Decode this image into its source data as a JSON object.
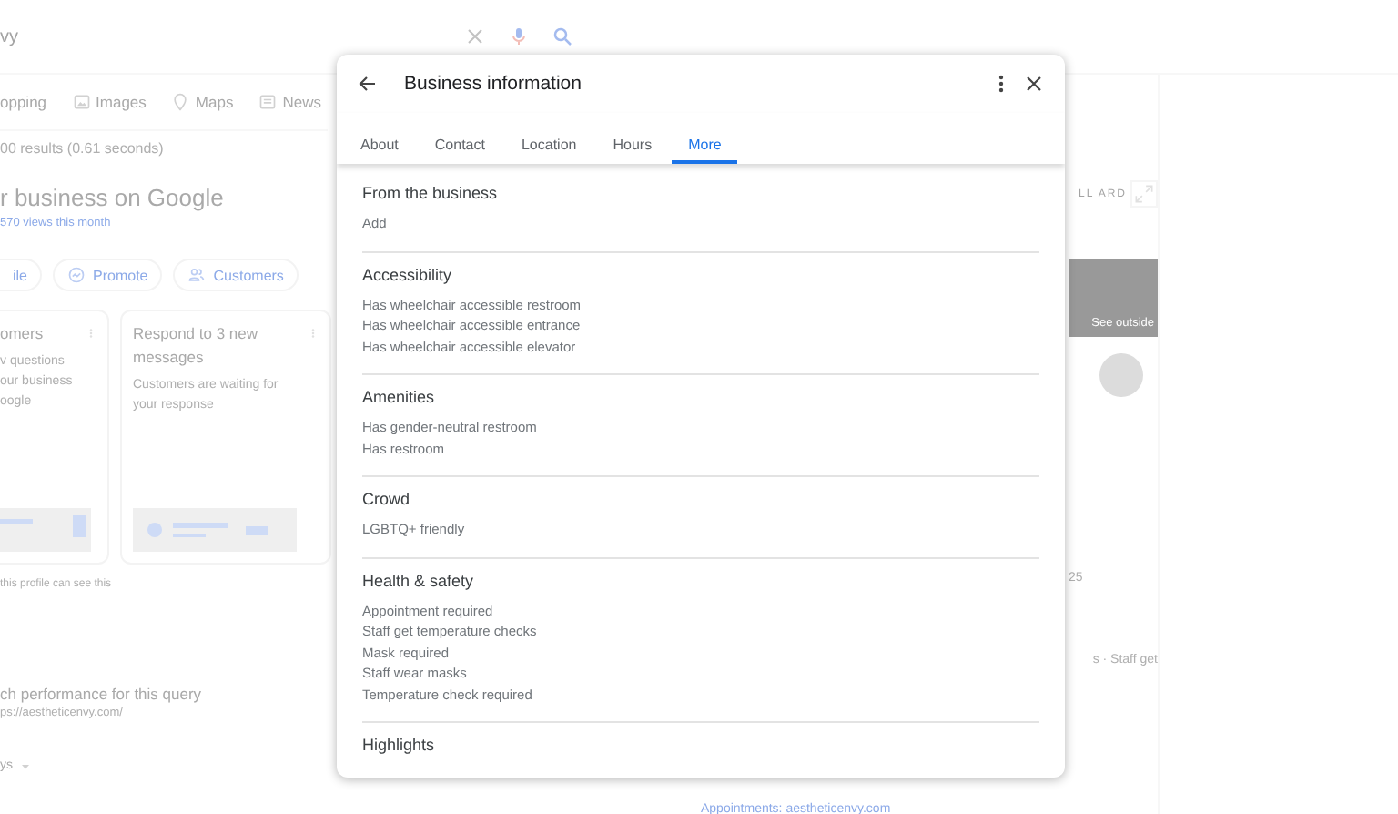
{
  "background": {
    "search_query": "vy",
    "nav_tabs": [
      "opping",
      "Images",
      "Maps",
      "News"
    ],
    "result_stats": "00 results (0.61 seconds)",
    "business_heading": "r business on Google",
    "views": "570 views this month",
    "action_chips": [
      {
        "label": "ile",
        "kind": "plain"
      },
      {
        "label": "Promote",
        "kind": "promote"
      },
      {
        "label": "Customers",
        "kind": "customers"
      }
    ],
    "cards": [
      {
        "title": [
          "omers"
        ],
        "lines": [
          "v questions",
          "our business",
          "oogle"
        ]
      },
      {
        "title": [
          "Respond to 3 new",
          "messages"
        ],
        "lines": [
          "Customers are waiting for",
          "your response"
        ]
      }
    ],
    "profile_note": "this profile can see this",
    "performance_title": "ch performance for this query",
    "performance_url": "ps://aestheticenvy.com/",
    "period": "ys",
    "right_panel": {
      "header": "LL ARD",
      "photo_label": "See outside",
      "number": "25",
      "snippet": "s · Staff get",
      "appointments": "Appointments: aestheticenvy.com"
    }
  },
  "dialog": {
    "title": "Business information",
    "tabs": [
      {
        "label": "About",
        "selected": false
      },
      {
        "label": "Contact",
        "selected": false
      },
      {
        "label": "Location",
        "selected": false
      },
      {
        "label": "Hours",
        "selected": false
      },
      {
        "label": "More",
        "selected": true
      }
    ],
    "sections": [
      {
        "heading": "From the business",
        "items": [
          "Add"
        ]
      },
      {
        "heading": "Accessibility",
        "items": [
          "Has wheelchair accessible restroom",
          "Has wheelchair accessible entrance",
          "Has wheelchair accessible elevator"
        ]
      },
      {
        "heading": "Amenities",
        "items": [
          "Has gender-neutral restroom",
          "Has restroom"
        ]
      },
      {
        "heading": "Crowd",
        "items": [
          "LGBTQ+ friendly"
        ]
      },
      {
        "heading": "Health & safety",
        "items": [
          "Appointment required",
          "Staff get temperature checks",
          "Mask required",
          "Staff wear masks",
          "Temperature check required"
        ]
      },
      {
        "heading": "Highlights"
      }
    ]
  }
}
